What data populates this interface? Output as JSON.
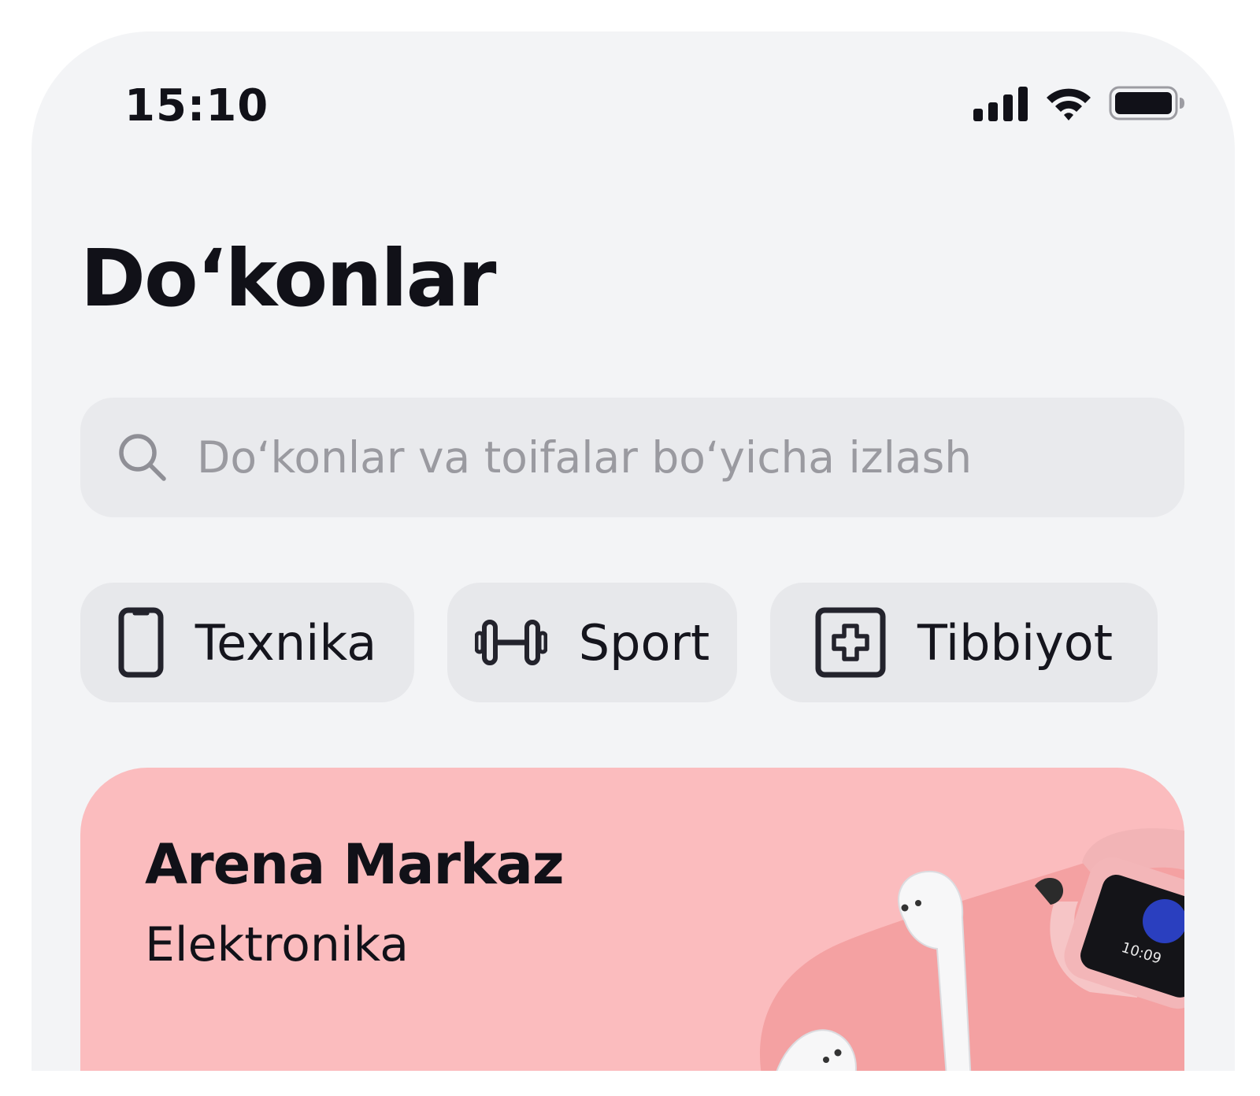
{
  "status_bar": {
    "time": "15:10",
    "icons": [
      "cellular-signal-icon",
      "wifi-icon",
      "battery-icon"
    ]
  },
  "page": {
    "title": "Do‘konlar"
  },
  "search": {
    "placeholder": "Do‘konlar va toifalar bo‘yicha izlash",
    "icon": "search-icon"
  },
  "categories": [
    {
      "label": "Texnika",
      "icon": "phone-icon"
    },
    {
      "label": "Sport",
      "icon": "dumbbell-icon"
    },
    {
      "label": "Tibbiyot",
      "icon": "medical-cross-icon"
    }
  ],
  "store_card": {
    "name": "Arena Markaz",
    "category": "Elektronika",
    "background_color": "#fbbcbe",
    "images": [
      "earbuds-image",
      "smartwatch-image"
    ],
    "watch_time": "10:09"
  }
}
